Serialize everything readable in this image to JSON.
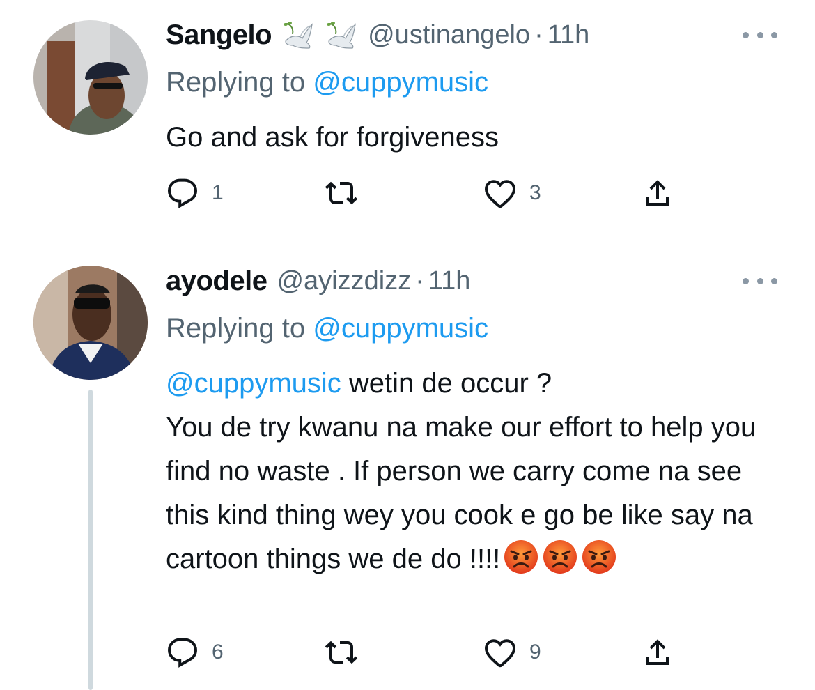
{
  "tweets": [
    {
      "name": "Sangelo",
      "name_emoji": [
        "dove-icon",
        "dove-icon"
      ],
      "handle": "@ustinangelo",
      "separator": "·",
      "time": "11h",
      "replying_prefix": "Replying to",
      "replying_to": "@cuppymusic",
      "text": "Go and ask for forgiveness",
      "counts": {
        "reply": "1",
        "retweet": "",
        "like": "3"
      }
    },
    {
      "name": "ayodele",
      "handle": "@ayizzdizz",
      "separator": "·",
      "time": "11h",
      "replying_prefix": "Replying to",
      "replying_to": "@cuppymusic",
      "text_mention": "@cuppymusic",
      "text_line1": " wetin de occur ?",
      "text_rest": "You de try kwanu na make our effort to help you find no waste . If person we carry come na see this kind thing wey you cook e go be like say na cartoon things we de do !!!!",
      "emojis": [
        "angry-face-icon",
        "angry-face-icon",
        "angry-face-icon"
      ],
      "counts": {
        "reply": "6",
        "retweet": "",
        "like": "9"
      }
    }
  ],
  "colors": {
    "text": "#0f1419",
    "secondary": "#536471",
    "link": "#1d9bf0",
    "divider": "#dfe3e6",
    "thread_line": "#cfd9de"
  }
}
